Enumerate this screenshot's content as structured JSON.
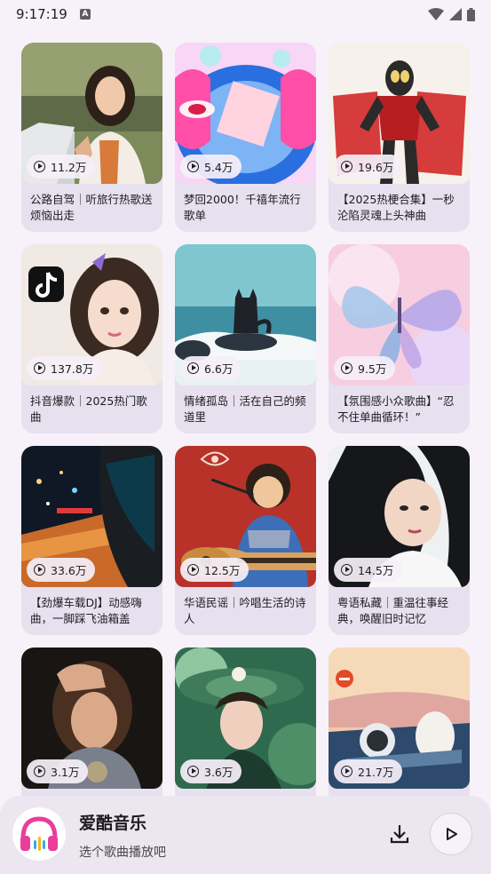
{
  "status_bar": {
    "time": "9:17:19",
    "notification_badge": "A"
  },
  "playlists": [
    {
      "plays": "11.2万",
      "title": "公路自驾｜听旅行热歌送烦恼出走",
      "art": "portrait-road"
    },
    {
      "plays": "5.4万",
      "title": "梦回2000！千禧年流行歌单",
      "art": "y2k-pink"
    },
    {
      "plays": "19.6万",
      "title": "【2025热梗合集】一秒沦陷灵魂上头神曲",
      "art": "hero-red"
    },
    {
      "plays": "137.8万",
      "title": "抖音爆款｜2025热门歌曲",
      "art": "tiktok-girl"
    },
    {
      "plays": "6.6万",
      "title": "情绪孤岛｜活在自己的频道里",
      "art": "cat-sea"
    },
    {
      "plays": "9.5万",
      "title": "【氛围感小众歌曲】“忍不住单曲循环！”",
      "art": "butterfly"
    },
    {
      "plays": "33.6万",
      "title": "【劲爆车载DJ】动感嗨曲，一脚踩飞油箱盖",
      "art": "night-car"
    },
    {
      "plays": "12.5万",
      "title": "华语民谣｜吟唱生活的诗人",
      "art": "guitar-red"
    },
    {
      "plays": "14.5万",
      "title": "粤语私藏｜重温往事经典，唤醒旧时记忆",
      "art": "retro-portrait"
    },
    {
      "plays": "3.1万",
      "title": "",
      "art": "dark-girl"
    },
    {
      "plays": "3.6万",
      "title": "",
      "art": "green-hat"
    },
    {
      "plays": "21.7万",
      "title": "",
      "art": "convertible"
    }
  ],
  "player": {
    "app_name": "爱酷音乐",
    "subtitle": "选个歌曲播放吧",
    "logo_icon": "headphones-icon",
    "download_icon": "download-icon",
    "play_icon": "play-icon",
    "accent_color": "#e83e9a"
  }
}
